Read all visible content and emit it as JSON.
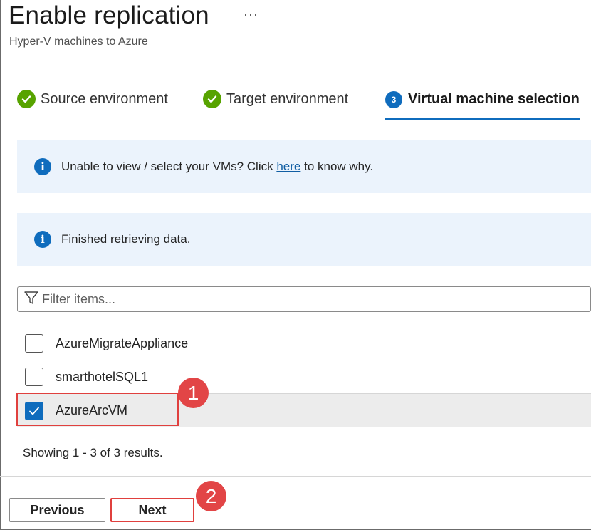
{
  "header": {
    "title": "Enable replication",
    "more": "···",
    "subtitle": "Hyper-V machines to Azure"
  },
  "tabs": [
    {
      "label": "Source environment",
      "state": "complete",
      "icon": "check-icon"
    },
    {
      "label": "Target environment",
      "state": "complete",
      "icon": "check-icon"
    },
    {
      "label": "Virtual machine selection",
      "state": "active",
      "number": "3"
    }
  ],
  "info_banners": [
    {
      "prefix": "Unable to view / select your VMs? Click ",
      "link": "here",
      "suffix": " to know why.",
      "icon": "info-icon"
    },
    {
      "text": "Finished retrieving data.",
      "icon": "info-icon"
    }
  ],
  "filter": {
    "placeholder": "Filter items...",
    "icon": "filter-icon"
  },
  "vm_list": [
    {
      "name": "AzureMigrateAppliance",
      "checked": false
    },
    {
      "name": "smarthotelSQL1",
      "checked": false
    },
    {
      "name": "AzureArcVM",
      "checked": true
    }
  ],
  "annotations": {
    "badge1": "1",
    "badge2": "2"
  },
  "results_text": "Showing 1 - 3 of 3 results.",
  "footer": {
    "previous_label": "Previous",
    "next_label": "Next"
  },
  "colors": {
    "accent": "#0f6cbd",
    "success": "#57a300",
    "annotation": "#e0403e",
    "info_bg": "#ebf3fc"
  }
}
